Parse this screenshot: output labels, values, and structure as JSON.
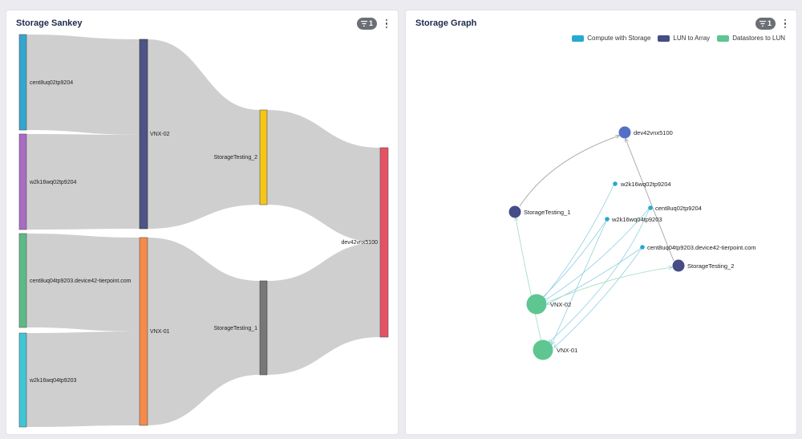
{
  "sankey": {
    "title": "Storage Sankey",
    "filter_count": "1",
    "nodes": [
      {
        "id": "s1",
        "label": "cent8uq02tp9204",
        "color": "#33a6cf"
      },
      {
        "id": "s2",
        "label": "w2k16wq02tp9204",
        "color": "#a96bc4"
      },
      {
        "id": "s3",
        "label": "cent8uq04tp9203.device42-tierpoint.com",
        "color": "#5dba86"
      },
      {
        "id": "s4",
        "label": "w2k16wq04tp9203",
        "color": "#3fc6d6"
      },
      {
        "id": "vnx02",
        "label": "VNX-02",
        "color": "#4d5488"
      },
      {
        "id": "vnx01",
        "label": "VNX-01",
        "color": "#f58a4c"
      },
      {
        "id": "st2",
        "label": "StorageTesting_2",
        "color": "#f5c518"
      },
      {
        "id": "st1",
        "label": "StorageTesting_1",
        "color": "#777777"
      },
      {
        "id": "dev",
        "label": "dev42vnx5100",
        "color": "#e65264"
      }
    ]
  },
  "graph": {
    "title": "Storage Graph",
    "filter_count": "1",
    "legend": [
      {
        "label": "Compute with Storage",
        "color": "#26a9d1"
      },
      {
        "label": "LUN to Array",
        "color": "#454c86"
      },
      {
        "label": "Datastores to LUN",
        "color": "#5ec690"
      }
    ],
    "nodes": [
      {
        "id": "dev42vnx5100",
        "label": "dev42vnx5100",
        "kind": "array"
      },
      {
        "id": "w2k16wq02tp9204",
        "label": "w2k16wq02tp9204",
        "kind": "compute"
      },
      {
        "id": "cent8uq02tp9204",
        "label": "cent8uq02tp9204",
        "kind": "compute"
      },
      {
        "id": "StorageTesting_1",
        "label": "StorageTesting_1",
        "kind": "lun"
      },
      {
        "id": "w2k16wq04tp9203",
        "label": "w2k16wq04tp9203",
        "kind": "compute"
      },
      {
        "id": "cent8uq04tp9203",
        "label": "cent8uq04tp9203.device42-tierpoint.com",
        "kind": "compute"
      },
      {
        "id": "StorageTesting_2",
        "label": "StorageTesting_2",
        "kind": "lun"
      },
      {
        "id": "VNX-02",
        "label": "VNX-02",
        "kind": "datastore"
      },
      {
        "id": "VNX-01",
        "label": "VNX-01",
        "kind": "datastore"
      }
    ]
  }
}
